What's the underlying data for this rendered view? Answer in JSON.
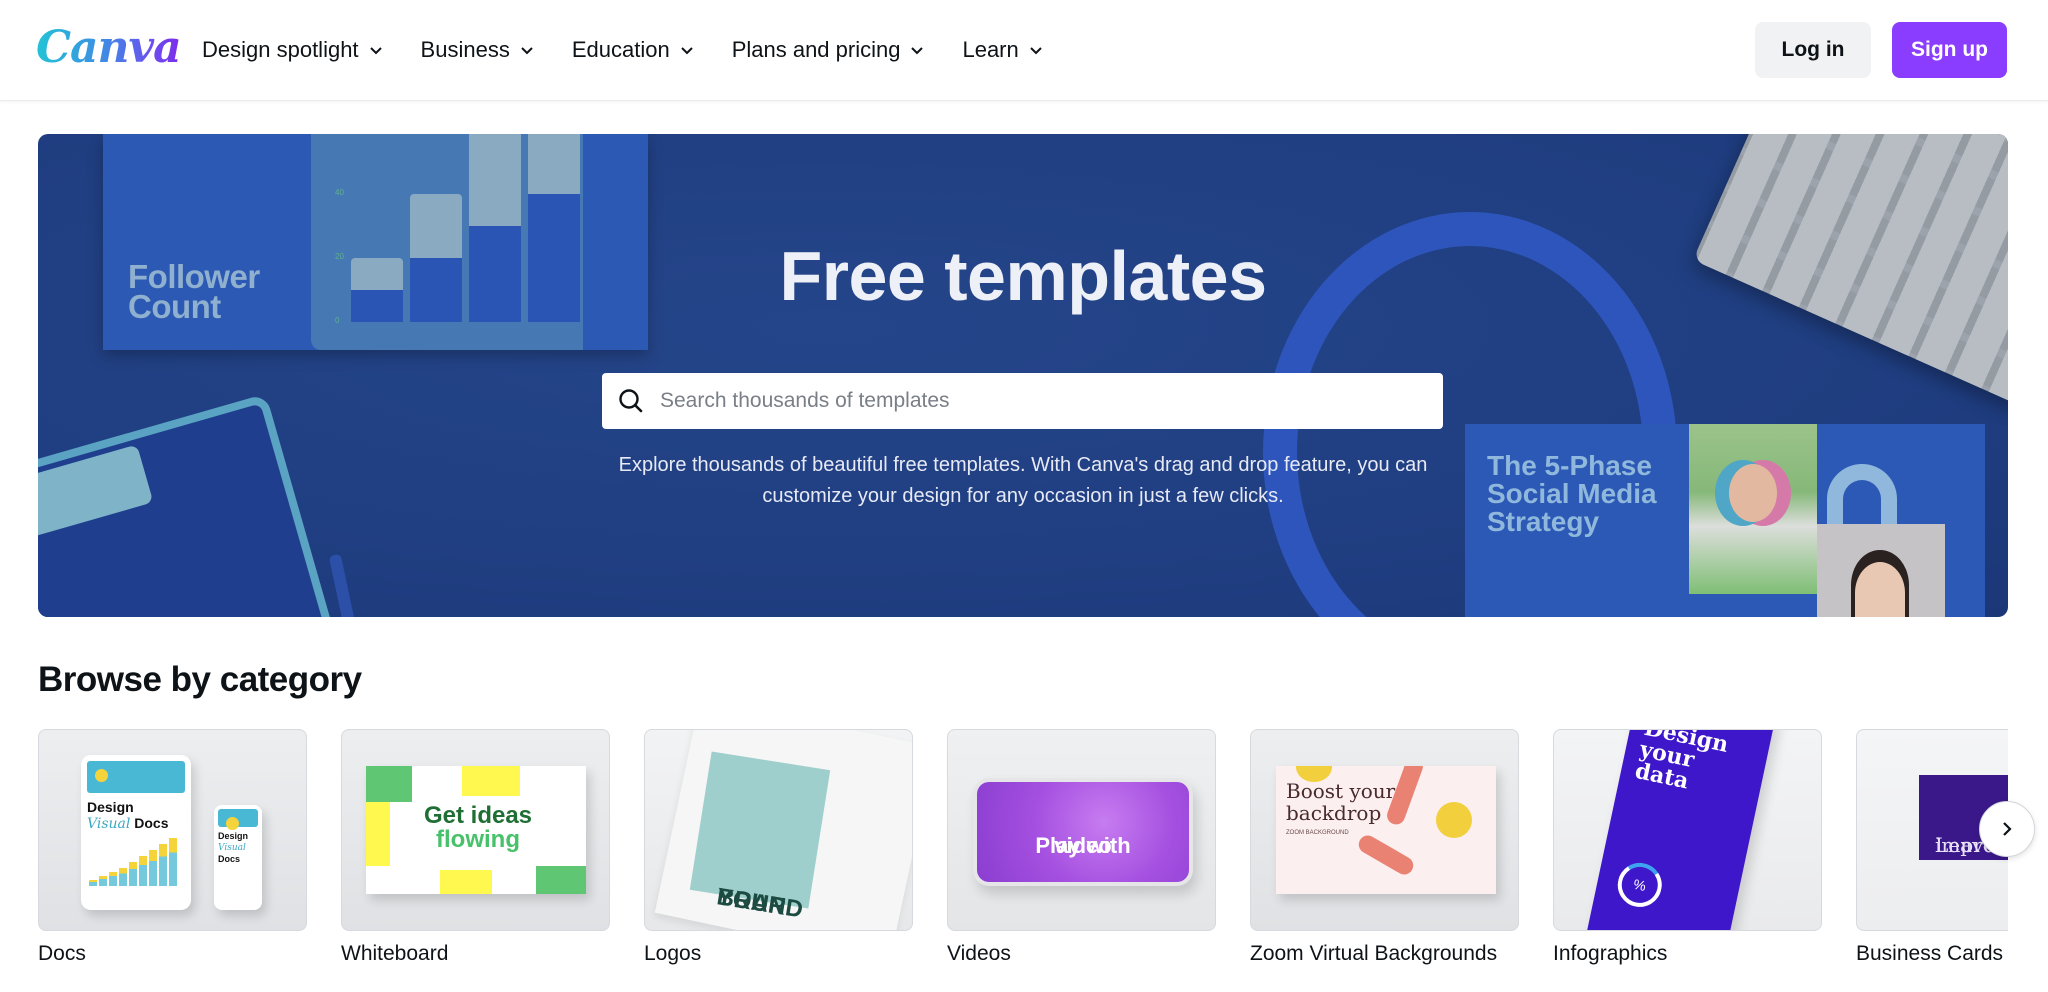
{
  "header": {
    "logo": "Canva",
    "nav": [
      {
        "label": "Design spotlight",
        "icon": "chevron-down-icon"
      },
      {
        "label": "Business",
        "icon": "chevron-down-icon"
      },
      {
        "label": "Education",
        "icon": "chevron-down-icon"
      },
      {
        "label": "Plans and pricing",
        "icon": "chevron-down-icon"
      },
      {
        "label": "Learn",
        "icon": "chevron-down-icon"
      }
    ],
    "login_label": "Log in",
    "signup_label": "Sign up",
    "colors": {
      "brand_purple": "#8b3dff",
      "login_bg": "#f1f2f4"
    }
  },
  "hero": {
    "title": "Free templates",
    "search": {
      "placeholder": "Search thousands of templates",
      "value": "",
      "icon": "search-icon"
    },
    "description": "Explore thousands of beautiful free templates. With Canva's drag and drop feature, you can customize your design for any occasion in just a few clicks.",
    "decor": {
      "follower_card_title": "Follower Count",
      "follower_chart_ticks": [
        "40",
        "20",
        "0"
      ],
      "strategy_card_title": "The 5-Phase Social Media Strategy"
    },
    "colors": {
      "background": "#203f82",
      "accent_ring": "#2d55bb"
    }
  },
  "browse": {
    "title": "Browse by category",
    "categories": [
      {
        "label": "Docs",
        "thumb_text": [
          "Design",
          "Visual",
          "Docs"
        ]
      },
      {
        "label": "Whiteboard",
        "thumb_text": [
          "Get ideas",
          "flowing"
        ]
      },
      {
        "label": "Logos",
        "thumb_text": [
          "YOUR",
          "BRAND"
        ]
      },
      {
        "label": "Videos",
        "thumb_text": [
          "Play with",
          "video"
        ]
      },
      {
        "label": "Zoom Virtual Backgrounds",
        "thumb_text": [
          "Boost your backdrop",
          "ZOOM BACKGROUND"
        ]
      },
      {
        "label": "Infographics",
        "thumb_text": [
          "Design your data",
          "%"
        ]
      },
      {
        "label": "Business Cards",
        "thumb_text": [
          "Leave",
          "impre"
        ]
      }
    ],
    "next_icon": "chevron-right-icon"
  }
}
